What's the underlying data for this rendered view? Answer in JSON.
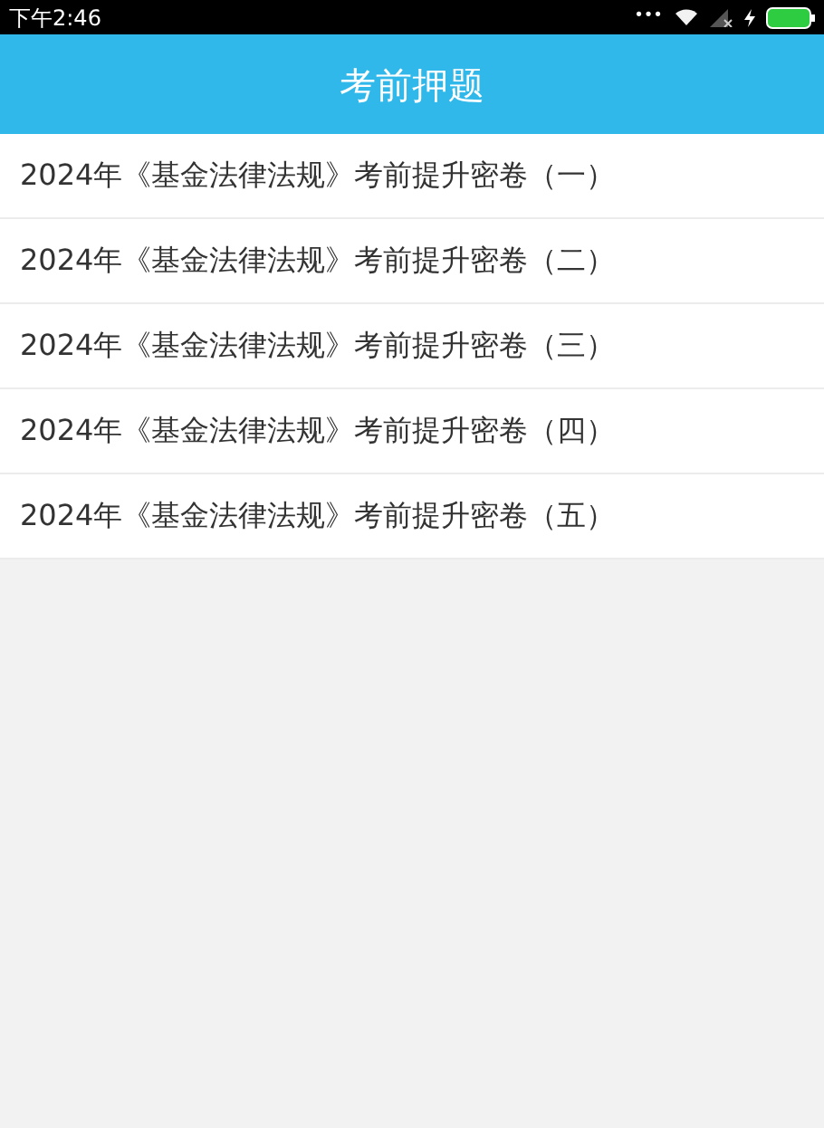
{
  "status_bar": {
    "time": "下午2:46",
    "more": "•••"
  },
  "header": {
    "title": "考前押题"
  },
  "items": [
    {
      "label": "2024年《基金法律法规》考前提升密卷（一）"
    },
    {
      "label": "2024年《基金法律法规》考前提升密卷（二）"
    },
    {
      "label": "2024年《基金法律法规》考前提升密卷（三）"
    },
    {
      "label": "2024年《基金法律法规》考前提升密卷（四）"
    },
    {
      "label": "2024年《基金法律法规》考前提升密卷（五）"
    }
  ]
}
